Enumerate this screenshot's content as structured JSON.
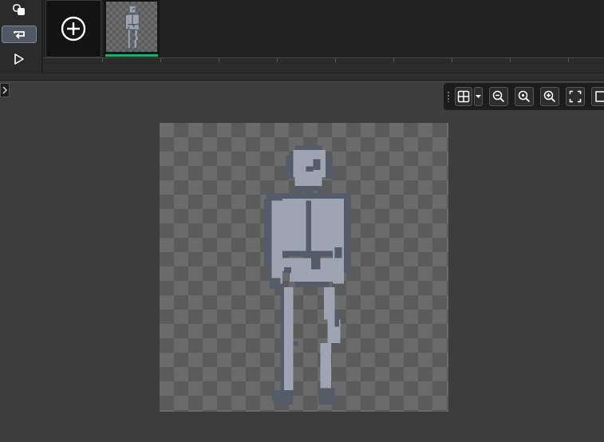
{
  "app": {
    "canvas_size": {
      "width": 32,
      "height": 32
    }
  },
  "side_tools": [
    {
      "id": "onion-skin",
      "icon": "onion-skin-icon",
      "active": false
    },
    {
      "id": "loop",
      "icon": "loop-icon",
      "active": true
    },
    {
      "id": "play",
      "icon": "play-icon",
      "active": false
    }
  ],
  "timeline": {
    "frames": [
      {
        "index": 1,
        "selected": true
      }
    ],
    "add_frame_icon": "plus-circle-icon"
  },
  "zoom_toolbar": {
    "buttons": [
      {
        "id": "grid",
        "icon": "grid-icon"
      },
      {
        "id": "zoom-out",
        "icon": "zoom-out-icon"
      },
      {
        "id": "zoom-reset",
        "icon": "zoom-reset-icon"
      },
      {
        "id": "zoom-in",
        "icon": "zoom-in-icon"
      },
      {
        "id": "fit",
        "icon": "fullscreen-icon"
      },
      {
        "id": "more",
        "icon": "frame-icon"
      }
    ]
  },
  "colors": {
    "sprite_fill": "#9ea4b1",
    "sprite_outline": "#545b69",
    "frame_selected": "#1fae6a",
    "checker_light": "#6b6b6b",
    "checker_dark": "#5b5b5b"
  }
}
